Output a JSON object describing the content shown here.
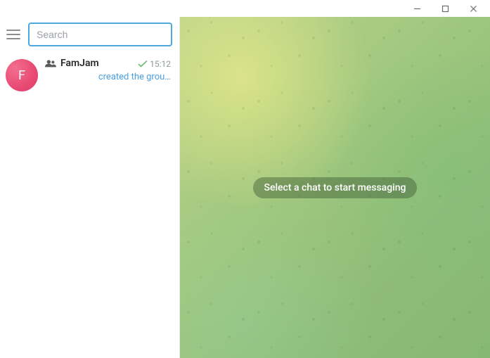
{
  "window": {
    "controls": {
      "minimize": "—",
      "maximize": "□",
      "close": "×"
    }
  },
  "search": {
    "placeholder": "Search",
    "value": ""
  },
  "chats": [
    {
      "avatar_letter": "F",
      "name": "FamJam",
      "is_group": true,
      "time": "15:12",
      "sent_check": true,
      "preview": "created the grou…"
    }
  ],
  "main": {
    "empty_message": "Select a chat to start messaging"
  }
}
